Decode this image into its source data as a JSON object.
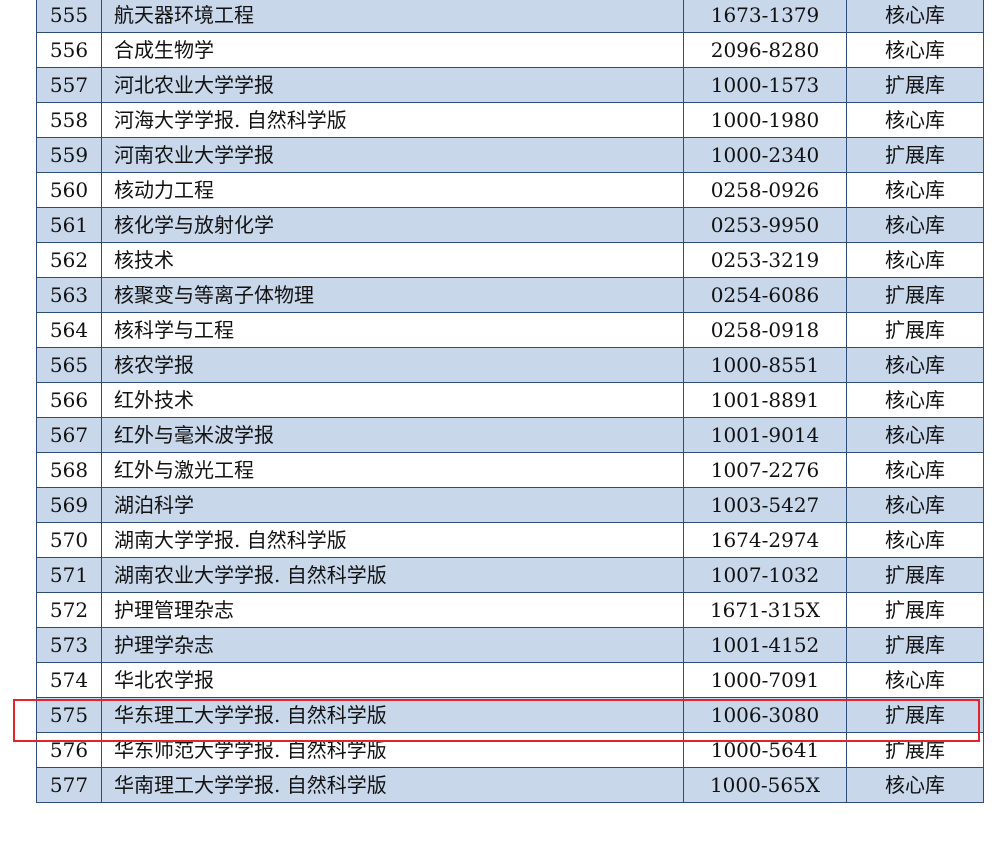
{
  "highlight_color": "#e3242b",
  "rows": [
    {
      "no": "555",
      "name": "航天器环境工程",
      "issn": "1673-1379",
      "db": "核心库"
    },
    {
      "no": "556",
      "name": "合成生物学",
      "issn": "2096-8280",
      "db": "核心库"
    },
    {
      "no": "557",
      "name": "河北农业大学学报",
      "issn": "1000-1573",
      "db": "扩展库"
    },
    {
      "no": "558",
      "name": "河海大学学报. 自然科学版",
      "issn": "1000-1980",
      "db": "核心库"
    },
    {
      "no": "559",
      "name": "河南农业大学学报",
      "issn": "1000-2340",
      "db": "扩展库"
    },
    {
      "no": "560",
      "name": "核动力工程",
      "issn": "0258-0926",
      "db": "核心库"
    },
    {
      "no": "561",
      "name": "核化学与放射化学",
      "issn": "0253-9950",
      "db": "核心库"
    },
    {
      "no": "562",
      "name": "核技术",
      "issn": "0253-3219",
      "db": "核心库"
    },
    {
      "no": "563",
      "name": "核聚变与等离子体物理",
      "issn": "0254-6086",
      "db": "扩展库"
    },
    {
      "no": "564",
      "name": "核科学与工程",
      "issn": "0258-0918",
      "db": "扩展库"
    },
    {
      "no": "565",
      "name": "核农学报",
      "issn": "1000-8551",
      "db": "核心库"
    },
    {
      "no": "566",
      "name": "红外技术",
      "issn": "1001-8891",
      "db": "核心库"
    },
    {
      "no": "567",
      "name": "红外与毫米波学报",
      "issn": "1001-9014",
      "db": "核心库"
    },
    {
      "no": "568",
      "name": "红外与激光工程",
      "issn": "1007-2276",
      "db": "核心库"
    },
    {
      "no": "569",
      "name": "湖泊科学",
      "issn": "1003-5427",
      "db": "核心库"
    },
    {
      "no": "570",
      "name": "湖南大学学报. 自然科学版",
      "issn": "1674-2974",
      "db": "核心库"
    },
    {
      "no": "571",
      "name": "湖南农业大学学报. 自然科学版",
      "issn": "1007-1032",
      "db": "扩展库"
    },
    {
      "no": "572",
      "name": "护理管理杂志",
      "issn": "1671-315X",
      "db": "扩展库"
    },
    {
      "no": "573",
      "name": "护理学杂志",
      "issn": "1001-4152",
      "db": "扩展库"
    },
    {
      "no": "574",
      "name": "华北农学报",
      "issn": "1000-7091",
      "db": "核心库"
    },
    {
      "no": "575",
      "name": "华东理工大学学报. 自然科学版",
      "issn": "1006-3080",
      "db": "扩展库"
    },
    {
      "no": "576",
      "name": "华东师范大学学报. 自然科学版",
      "issn": "1000-5641",
      "db": "扩展库"
    },
    {
      "no": "577",
      "name": "华南理工大学学报. 自然科学版",
      "issn": "1000-565X",
      "db": "核心库"
    }
  ]
}
